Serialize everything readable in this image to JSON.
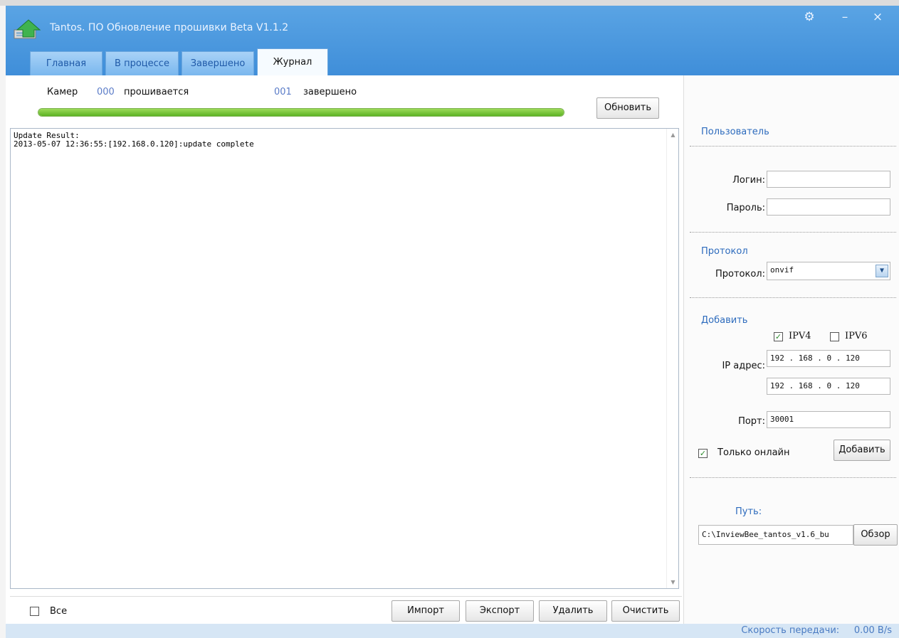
{
  "window": {
    "title": "Tantos. ПО Обновление прошивки Beta V1.1.2",
    "controls": {
      "settings_glyph": "⚙",
      "minimize_glyph": "–",
      "close_glyph": "×"
    }
  },
  "tabs": [
    {
      "label": "Главная",
      "active": false
    },
    {
      "label": "В процессе",
      "active": false
    },
    {
      "label": "Завершено",
      "active": false
    },
    {
      "label": "Журнал",
      "active": true
    }
  ],
  "progress": {
    "cameras_label": "Камер",
    "flashing_count": "000",
    "flashing_label": "прошивается",
    "done_count": "001",
    "done_label": "завершено",
    "percent": 100,
    "refresh_button": "Обновить"
  },
  "log": {
    "lines": [
      "Update Result:",
      "2013-05-07 12:36:55:[192.168.0.120]:update complete"
    ]
  },
  "log_actions": {
    "select_all_label": "Все",
    "select_all_checked": false,
    "import_label": "Импорт",
    "export_label": "Экспорт",
    "delete_label": "Удалить",
    "clear_label": "Очистить"
  },
  "user": {
    "section_title": "Пользователь",
    "login_label": "Логин:",
    "login_value": "",
    "password_label": "Пароль:",
    "password_value": ""
  },
  "protocol": {
    "section_title": "Протокол",
    "label": "Протокол:",
    "selected": "onvif"
  },
  "add": {
    "section_title": "Добавить",
    "ipv4_label": "IPV4",
    "ipv4_checked": true,
    "ipv6_label": "IPV6",
    "ipv6_checked": false,
    "ip_label": "IP адрес:",
    "ip_start": "192 . 168 .  0  . 120",
    "ip_end": "192 . 168 .  0  . 120",
    "port_label": "Порт:",
    "port_value": "30001",
    "online_only_label": "Только онлайн",
    "online_only_checked": true,
    "add_button": "Добавить"
  },
  "path": {
    "label": "Путь:",
    "value": "C:\\InviewBee_tantos_v1.6_bu",
    "browse_button": "Обзор"
  },
  "status": {
    "speed_label": "Скорость передачи:",
    "speed_value": "0.00",
    "speed_unit": "B/s"
  },
  "colors": {
    "titlebar": "#4a97dd",
    "accent_text": "#2d6bbd",
    "progress_green": "#6cc52d"
  }
}
